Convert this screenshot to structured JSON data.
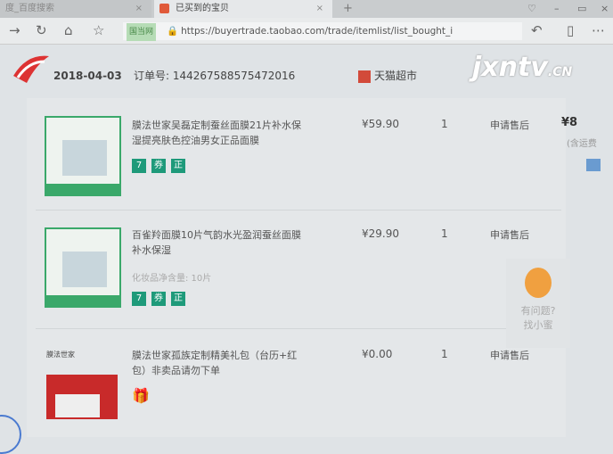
{
  "browser": {
    "tabs": [
      {
        "label": "度_百度搜索"
      },
      {
        "label": "已买到的宝贝"
      }
    ],
    "url": "https://buyertrade.taobao.com/trade/itemlist/list_bought_i",
    "url_badge": "国当网"
  },
  "order": {
    "date": "2018-04-03",
    "order_no": "订单号: 144267588575472016",
    "shop": "天猫超市",
    "total": "¥8",
    "total_note": "(含运费"
  },
  "items": [
    {
      "title": "膜法世家吴磊定制蚕丝面膜21片补水保湿提亮肤色控油男女正品面膜",
      "price": "¥59.90",
      "qty": "1",
      "action": "申请售后",
      "badges": [
        "7",
        "券",
        "正"
      ]
    },
    {
      "title": "百雀羚面膜10片气韵水光盈润蚕丝面膜补水保湿",
      "spec": "化妆品净含量: 10片",
      "price": "¥29.90",
      "qty": "1",
      "action": "申请售后",
      "badges": [
        "7",
        "券",
        "正"
      ]
    },
    {
      "title": "膜法世家孤族定制精美礼包（台历+红包）非卖品请勿下单",
      "price": "¥0.00",
      "qty": "1",
      "action": "申请售后",
      "thumb_label": "膜法世家"
    }
  ],
  "helper": {
    "line1": "有问题?",
    "line2": "找小蜜"
  },
  "watermark": {
    "main": "jxntv",
    "suffix": ".CN"
  }
}
